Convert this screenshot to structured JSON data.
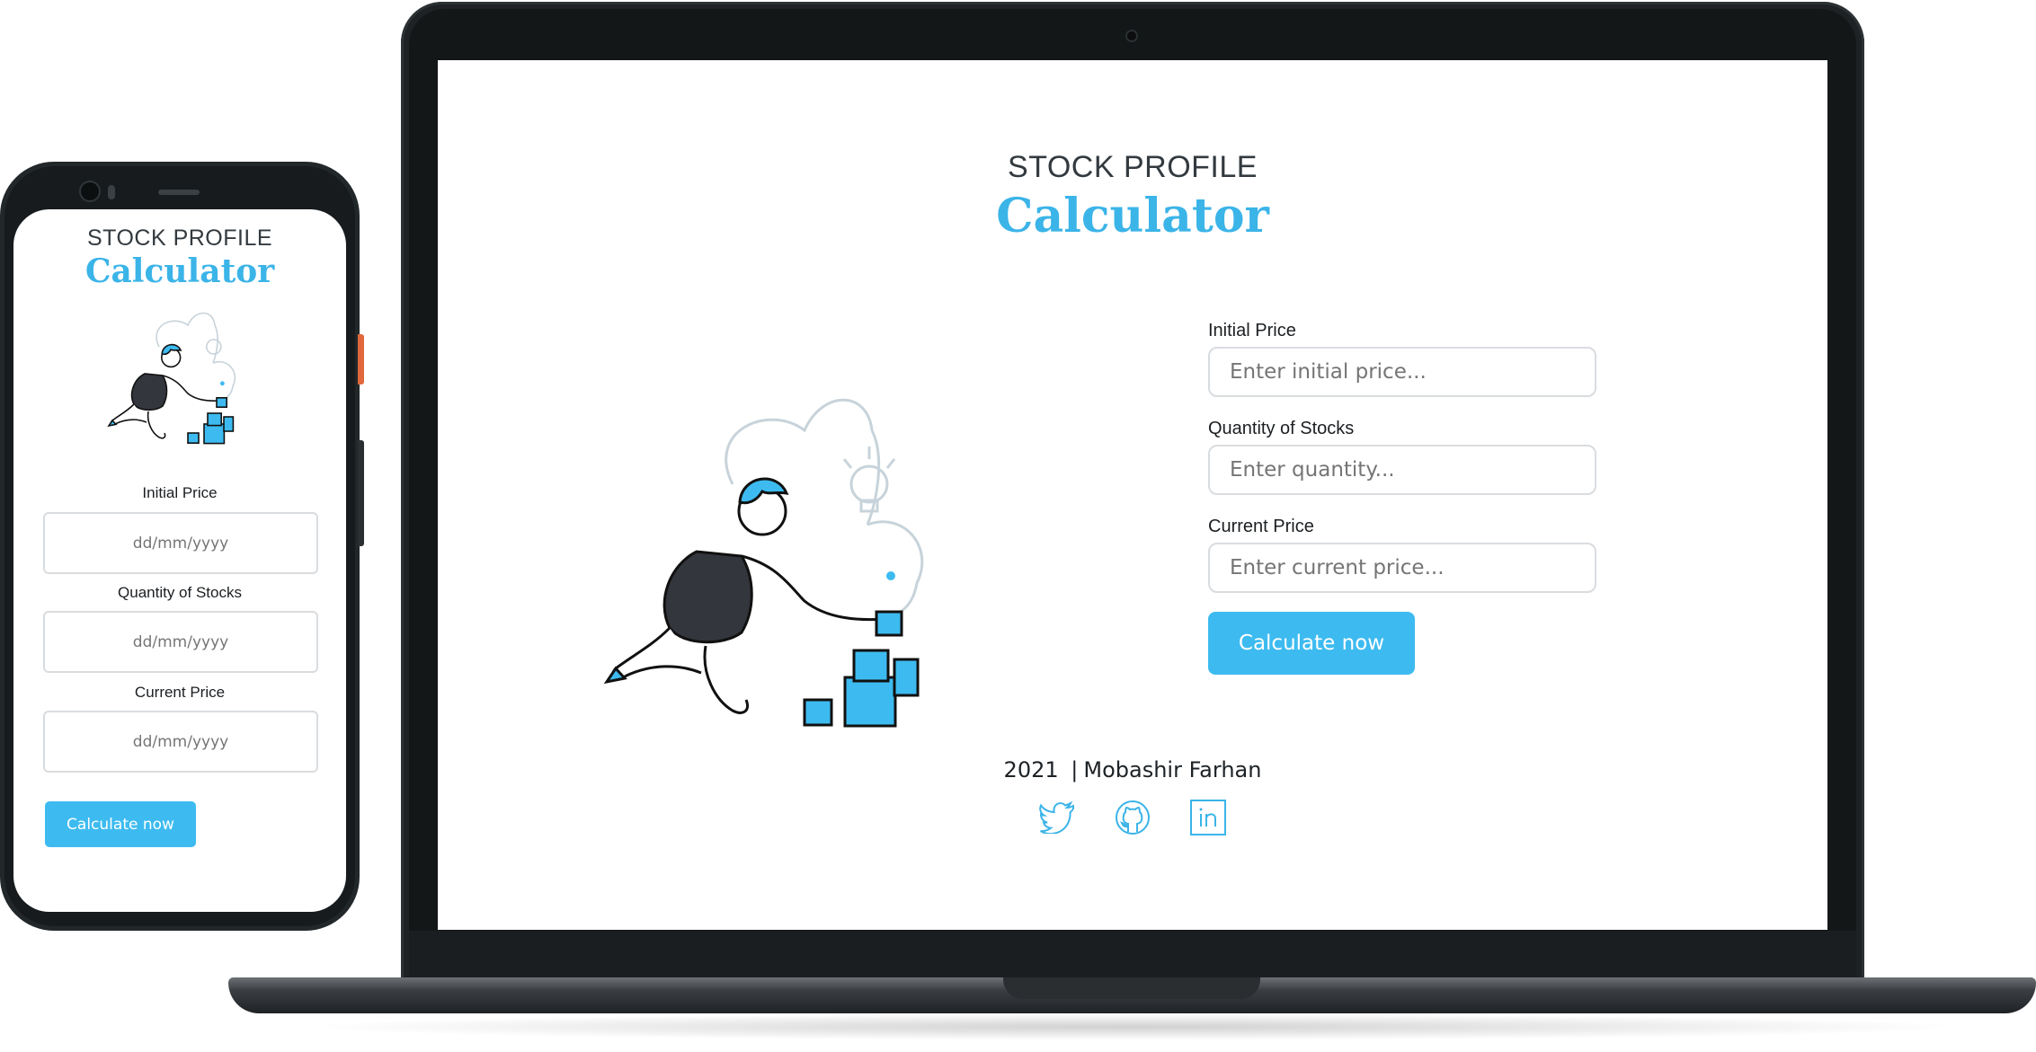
{
  "app": {
    "title_top": "STOCK PROFILE",
    "title_main": "Calculator"
  },
  "form": {
    "initial_price_label": "Initial Price",
    "initial_price_placeholder": "Enter initial price...",
    "quantity_label": "Quantity of Stocks",
    "quantity_placeholder": "Enter quantity...",
    "current_price_label": "Current Price",
    "current_price_placeholder": "Enter current price...",
    "submit_label": "Calculate now"
  },
  "mobile_form": {
    "initial_price_placeholder": "dd/mm/yyyy",
    "quantity_placeholder": "dd/mm/yyyy",
    "current_price_placeholder": "dd/mm/yyyy"
  },
  "footer": {
    "year": "2021",
    "separator": "|",
    "author": "Mobashir Farhan",
    "social_icons": [
      "twitter-icon",
      "github-icon",
      "linkedin-icon"
    ]
  },
  "colors": {
    "accent": "#3dbbf0",
    "title_accent": "#3bb4e8",
    "text": "#1b1f22",
    "device_frame": "#1e2224"
  }
}
